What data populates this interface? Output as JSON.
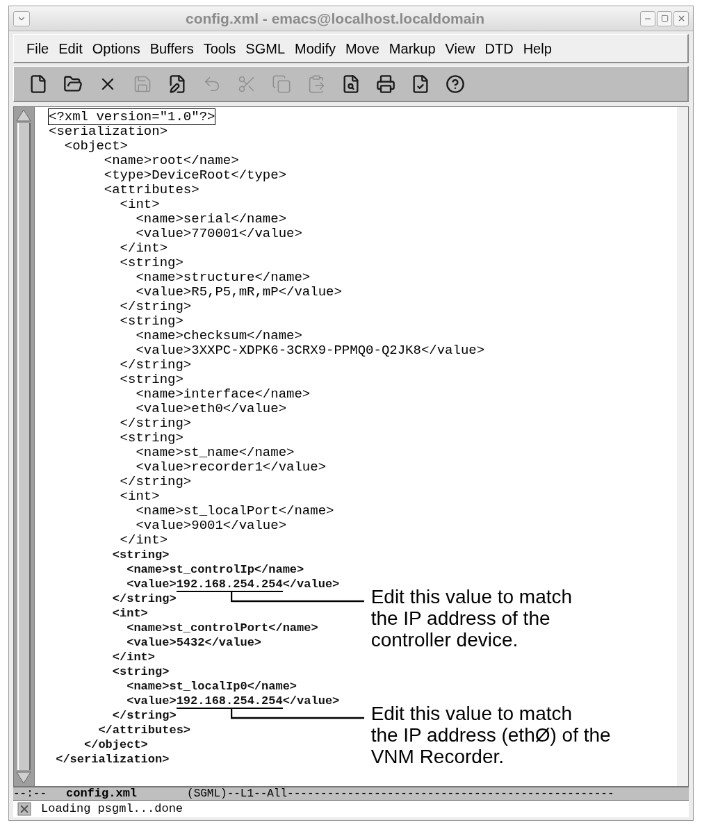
{
  "window": {
    "title": "config.xml - emacs@localhost.localdomain"
  },
  "menu": [
    "File",
    "Edit",
    "Options",
    "Buffers",
    "Tools",
    "SGML",
    "Modify",
    "Move",
    "Markup",
    "View",
    "DTD",
    "Help"
  ],
  "toolbar": [
    {
      "kind": "new",
      "disabled": false
    },
    {
      "kind": "open",
      "disabled": false
    },
    {
      "kind": "close",
      "disabled": false
    },
    {
      "kind": "save",
      "disabled": true
    },
    {
      "kind": "edit",
      "disabled": false
    },
    {
      "kind": "undo",
      "disabled": true
    },
    {
      "kind": "cut",
      "disabled": true
    },
    {
      "kind": "copy",
      "disabled": true
    },
    {
      "kind": "paste",
      "disabled": true
    },
    {
      "kind": "search",
      "disabled": false
    },
    {
      "kind": "print",
      "disabled": false
    },
    {
      "kind": "spell",
      "disabled": false
    },
    {
      "kind": "help",
      "disabled": false
    }
  ],
  "lines": [
    {
      "kind": "plain",
      "cursor": true,
      "text": "<?xml version=\"1.0\"?>"
    },
    {
      "kind": "plain",
      "cursor": false,
      "text": "<serialization>"
    },
    {
      "kind": "plain",
      "cursor": false,
      "text": "  <object>"
    },
    {
      "kind": "plain",
      "cursor": false,
      "text": "       <name>root</name>"
    },
    {
      "kind": "plain",
      "cursor": false,
      "text": "       <type>DeviceRoot</type>"
    },
    {
      "kind": "plain",
      "cursor": false,
      "text": "       <attributes>"
    },
    {
      "kind": "plain",
      "cursor": false,
      "text": "         <int>"
    },
    {
      "kind": "plain",
      "cursor": false,
      "text": "           <name>serial</name>"
    },
    {
      "kind": "plain",
      "cursor": false,
      "text": "           <value>770001</value>"
    },
    {
      "kind": "plain",
      "cursor": false,
      "text": "         </int>"
    },
    {
      "kind": "plain",
      "cursor": false,
      "text": "         <string>"
    },
    {
      "kind": "plain",
      "cursor": false,
      "text": "           <name>structure</name>"
    },
    {
      "kind": "plain",
      "cursor": false,
      "text": "           <value>R5,P5,mR,mP</value>"
    },
    {
      "kind": "plain",
      "cursor": false,
      "text": "         </string>"
    },
    {
      "kind": "plain",
      "cursor": false,
      "text": "         <string>"
    },
    {
      "kind": "plain",
      "cursor": false,
      "text": "           <name>checksum</name>"
    },
    {
      "kind": "plain",
      "cursor": false,
      "text": "           <value>3XXPC-XDPK6-3CRX9-PPMQ0-Q2JK8</value>"
    },
    {
      "kind": "plain",
      "cursor": false,
      "text": "         </string>"
    },
    {
      "kind": "plain",
      "cursor": false,
      "text": "         <string>"
    },
    {
      "kind": "plain",
      "cursor": false,
      "text": "           <name>interface</name>"
    },
    {
      "kind": "plain",
      "cursor": false,
      "text": "           <value>eth0</value>"
    },
    {
      "kind": "plain",
      "cursor": false,
      "text": "         </string>"
    },
    {
      "kind": "plain",
      "cursor": false,
      "text": "         <string>"
    },
    {
      "kind": "plain",
      "cursor": false,
      "text": "           <name>st_name</name>"
    },
    {
      "kind": "plain",
      "cursor": false,
      "text": "           <value>recorder1</value>"
    },
    {
      "kind": "plain",
      "cursor": false,
      "text": "         </string>"
    },
    {
      "kind": "plain",
      "cursor": false,
      "text": "         <int>"
    },
    {
      "kind": "plain",
      "cursor": false,
      "text": "           <name>st_localPort</name>"
    },
    {
      "kind": "plain",
      "cursor": false,
      "text": "           <value>9001</value>"
    },
    {
      "kind": "plain",
      "cursor": false,
      "text": "         </int>"
    },
    {
      "kind": "bold",
      "cursor": false,
      "text": "         <string>"
    },
    {
      "kind": "bold",
      "cursor": false,
      "text": "           <name>st_controlIp</name>"
    },
    {
      "kind": "bold",
      "cursor": false,
      "parts": [
        "           <value>",
        "192.168.254.254",
        "</value>"
      ],
      "callout": [
        "Edit this value to match",
        "the IP address of the",
        "controller device."
      ]
    },
    {
      "kind": "bold",
      "cursor": false,
      "text": "         </string>"
    },
    {
      "kind": "bold",
      "cursor": false,
      "text": "         <int>"
    },
    {
      "kind": "bold",
      "cursor": false,
      "text": "           <name>st_controlPort</name>"
    },
    {
      "kind": "bold",
      "cursor": false,
      "text": "           <value>5432</value>"
    },
    {
      "kind": "bold",
      "cursor": false,
      "text": "         </int>"
    },
    {
      "kind": "bold",
      "cursor": false,
      "text": "         <string>"
    },
    {
      "kind": "bold",
      "cursor": false,
      "text": "           <name>st_localIp0</name>"
    },
    {
      "kind": "bold",
      "cursor": false,
      "parts": [
        "           <value>",
        "192.168.254.254",
        "</value>"
      ],
      "callout": [
        "Edit this value to match",
        "the IP address (ethØ) of the",
        "VNM Recorder."
      ]
    },
    {
      "kind": "bold",
      "cursor": false,
      "text": "         </string>"
    },
    {
      "kind": "bold",
      "cursor": false,
      "text": "       </attributes>"
    },
    {
      "kind": "bold",
      "cursor": false,
      "text": "     </object>"
    },
    {
      "kind": "bold",
      "cursor": false,
      "text": " </serialization>"
    }
  ],
  "mode_line": {
    "status": "--:--",
    "buffer": "config.xml",
    "info": "(SGML)--L1--All-------------------------------------------------"
  },
  "echo_area": "Loading psgml...done"
}
